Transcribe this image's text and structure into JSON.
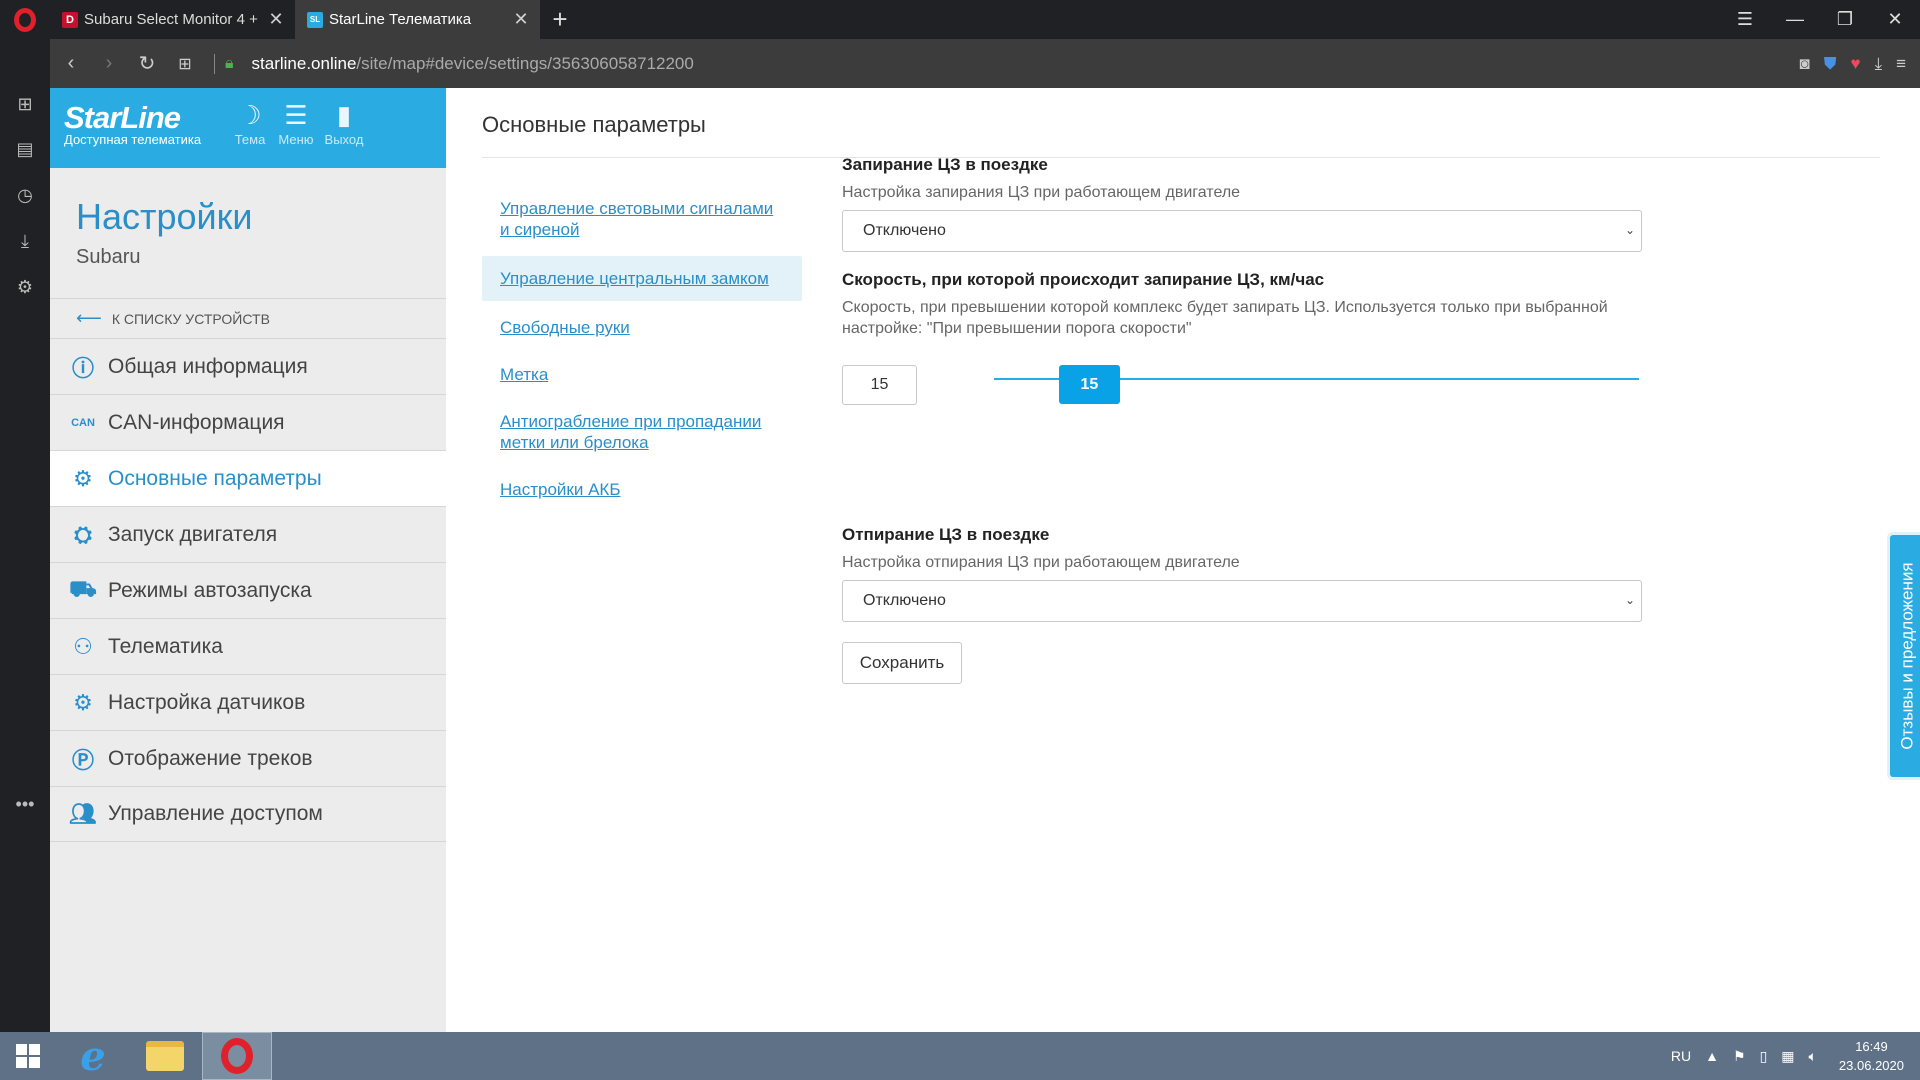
{
  "browser": {
    "tabs": [
      {
        "title": "Subaru Select Monitor 4 +",
        "favicon": "D",
        "favicon_color": "#c8102e",
        "active": false
      },
      {
        "title": "StarLine Телематика",
        "favicon": "SL",
        "favicon_color": "#2aace2",
        "active": true
      }
    ],
    "new_tab": "+",
    "url_host": "starline.online",
    "url_path": "/site/map#device/settings/356306058712200"
  },
  "header": {
    "brand_name": "StarLine",
    "brand_tagline": "Доступная телематика",
    "theme_label": "Тема",
    "menu_label": "Меню",
    "exit_label": "Выход",
    "accent_color": "#2aace2"
  },
  "sidebar": {
    "title": "Настройки",
    "device": "Subaru",
    "back_link": "К списку устройств",
    "items": [
      {
        "label": "Общая информация",
        "icon": "info-icon"
      },
      {
        "label": "CAN-информация",
        "icon": "can-icon"
      },
      {
        "label": "Основные параметры",
        "icon": "gear-icon",
        "active": true
      },
      {
        "label": "Запуск двигателя",
        "icon": "engine-icon"
      },
      {
        "label": "Режимы автозапуска",
        "icon": "autostart-icon"
      },
      {
        "label": "Телематика",
        "icon": "telematics-icon"
      },
      {
        "label": "Настройка датчиков",
        "icon": "sensors-icon"
      },
      {
        "label": "Отображение треков",
        "icon": "tracks-icon"
      },
      {
        "label": "Управление доступом",
        "icon": "users-icon"
      }
    ]
  },
  "main": {
    "heading": "Основные параметры",
    "sublinks": [
      {
        "label": "Управление световыми сигналами и сиреной"
      },
      {
        "label": "Управление центральным замком",
        "active": true
      },
      {
        "label": "Свободные руки"
      },
      {
        "label": "Метка"
      },
      {
        "label": "Антиограбление при пропадании метки или брелока"
      },
      {
        "label": "Настройки АКБ"
      }
    ],
    "lock_in_drive": {
      "label": "Запирание ЦЗ в поездке",
      "description": "Настройка запирания ЦЗ при работающем двигателе",
      "value": "Отключено"
    },
    "lock_speed": {
      "label": "Скорость, при которой происходит запирание ЦЗ, км/час",
      "description": "Скорость, при превышении которой комплекс будет запирать ЦЗ. Используется только при выбранной настройке: \"При превышении порога скорости\"",
      "value": "15",
      "slider_value": "15",
      "slider_level": 0.11
    },
    "unlock_in_drive": {
      "label": "Отпирание ЦЗ в поездке",
      "description": "Настройка отпирания ЦЗ при работающем двигателе",
      "value": "Отключено"
    },
    "save_label": "Сохранить",
    "feedback_label": "Отзывы и предложения"
  },
  "taskbar": {
    "language": "RU",
    "time": "16:49",
    "date": "23.06.2020"
  }
}
